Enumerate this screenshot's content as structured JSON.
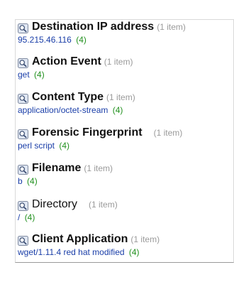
{
  "facets": [
    {
      "title": "Destination IP address",
      "item_count": "(1 item)",
      "value": "95.215.46.116",
      "value_count": "(4)"
    },
    {
      "title": "Action Event",
      "item_count": "(1 item)",
      "value": "get",
      "value_count": "(4)"
    },
    {
      "title": "Content Type",
      "item_count": "(1 item)",
      "value": "application/octet-stream",
      "value_count": "(4)"
    },
    {
      "title": "Forensic Fingerprint",
      "item_count": "(1 item)",
      "value": "perl script",
      "value_count": "(4)"
    },
    {
      "title": "Filename",
      "item_count": "(1 item)",
      "value": "b",
      "value_count": "(4)"
    },
    {
      "title": "Directory",
      "item_count": "(1 item)",
      "value": "/",
      "value_count": "(4)"
    },
    {
      "title": "Client Application",
      "item_count": "(1 item)",
      "value": "wget/1.11.4 red hat modified",
      "value_count": "(4)"
    }
  ],
  "colors": {
    "title": "#111111",
    "count": "#9a9a9a",
    "value_link": "#1a3ea8",
    "value_count": "#22911f",
    "icon_fill": "#dfe6f2",
    "icon_border": "#7f8aa0"
  },
  "icons": {
    "facet_icon": "magnifier-icon"
  }
}
